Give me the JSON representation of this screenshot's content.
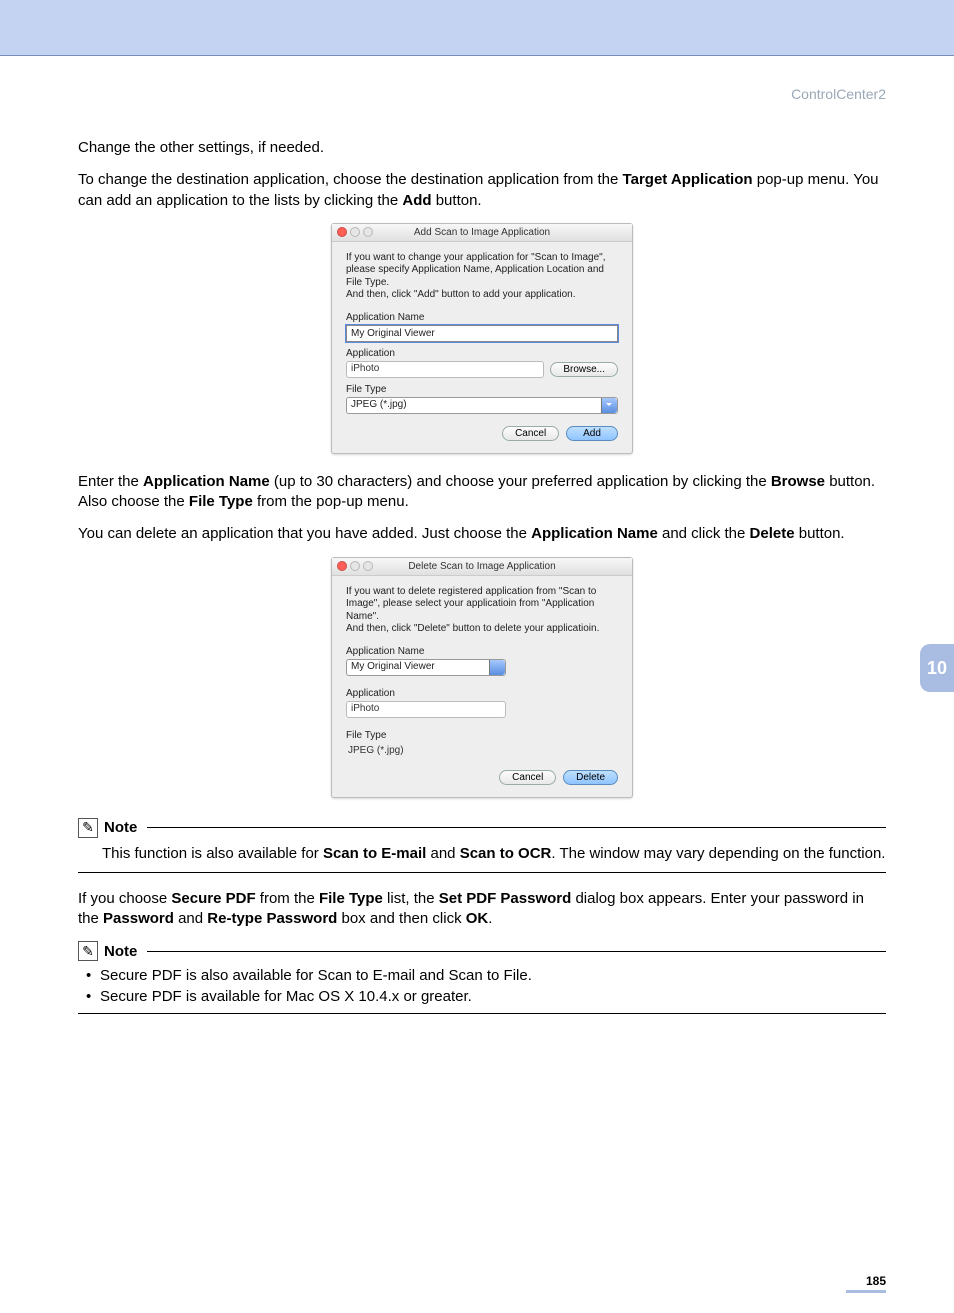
{
  "header": {
    "section": "ControlCenter2"
  },
  "page": {
    "tab": "10",
    "number": "185"
  },
  "para1": "Change the other settings, if needed.",
  "para2_a": "To change the destination application, choose the destination application from the ",
  "para2_b": "Target Application",
  "para2_c": " pop-up menu. You can add an application to the lists by clicking the ",
  "para2_d": "Add",
  "para2_e": " button.",
  "dialog_add": {
    "title": "Add Scan to Image Application",
    "instructions": "If you want to change your application for \"Scan to Image\", please specify Application Name, Application Location and File Type.\nAnd then, click \"Add\" button to add your application.",
    "app_name_label": "Application Name",
    "app_name_value": "My Original Viewer",
    "application_label": "Application",
    "application_value": "iPhoto",
    "browse": "Browse...",
    "file_type_label": "File Type",
    "file_type_value": "JPEG (*.jpg)",
    "cancel": "Cancel",
    "add": "Add"
  },
  "para3_a": "Enter the ",
  "para3_b": "Application Name",
  "para3_c": " (up to 30 characters) and choose your preferred application by clicking the ",
  "para3_d": "Browse",
  "para3_e": " button. Also choose the ",
  "para3_f": "File Type",
  "para3_g": " from the pop-up menu.",
  "para4_a": "You can delete an application that you have added. Just choose the ",
  "para4_b": "Application Name",
  "para4_c": " and click the ",
  "para4_d": "Delete",
  "para4_e": " button.",
  "dialog_delete": {
    "title": "Delete Scan to Image Application",
    "instructions": "If you want to delete registered application from \"Scan to Image\", please select your applicatioin from \"Application Name\".\nAnd then, click \"Delete\" button to delete your applicatioin.",
    "app_name_label": "Application Name",
    "app_name_value": "My Original Viewer",
    "application_label": "Application",
    "application_value": "iPhoto",
    "file_type_label": "File Type",
    "file_type_value": "JPEG (*.jpg)",
    "cancel": "Cancel",
    "delete": "Delete"
  },
  "note1": {
    "title": "Note",
    "body_a": "This function is also available for ",
    "body_b": "Scan to E-mail",
    "body_c": " and ",
    "body_d": "Scan to OCR",
    "body_e": ". The window may vary depending on the function."
  },
  "para5_a": "If you choose ",
  "para5_b": "Secure PDF",
  "para5_c": " from the ",
  "para5_d": "File Type",
  "para5_e": " list, the ",
  "para5_f": "Set PDF Password",
  "para5_g": " dialog box appears. Enter your password in the ",
  "para5_h": "Password",
  "para5_i": " and ",
  "para5_j": "Re-type Password",
  "para5_k": " box and then click ",
  "para5_l": "OK",
  "para5_m": ".",
  "note2": {
    "title": "Note",
    "item1": "Secure PDF is also available for Scan to E-mail and Scan to File.",
    "item2": "Secure PDF is available for Mac OS X 10.4.x or greater."
  }
}
